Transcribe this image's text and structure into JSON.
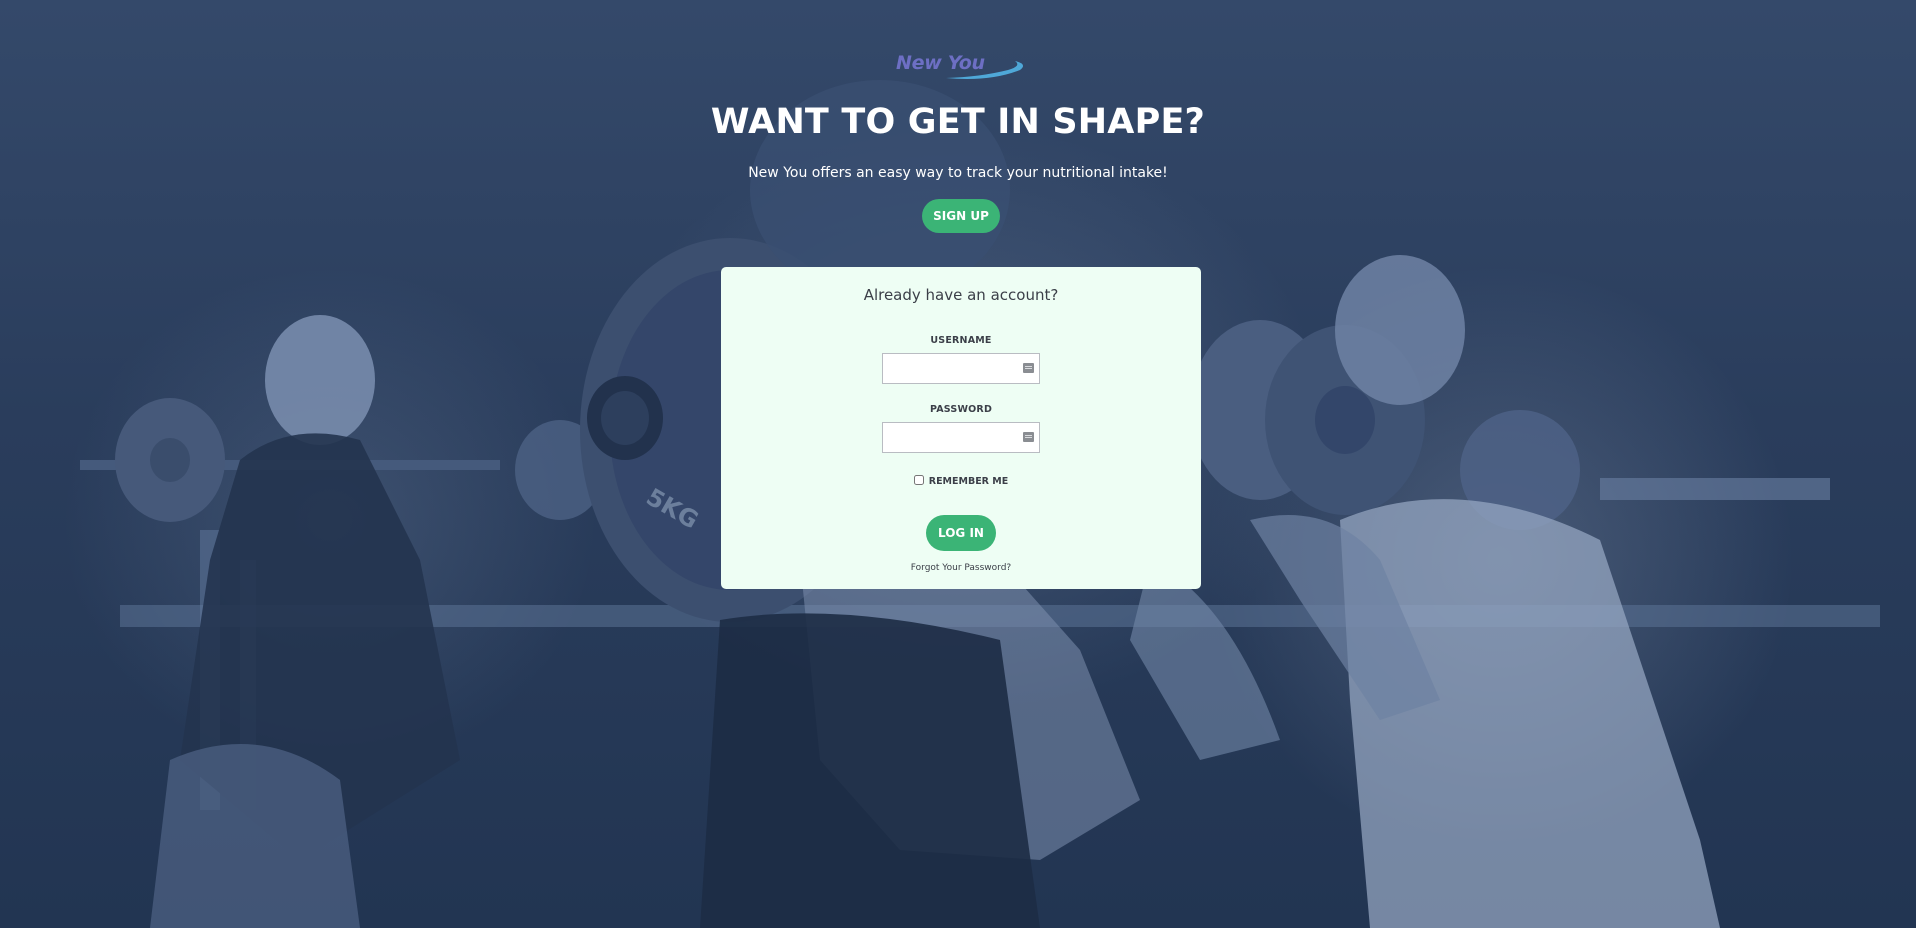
{
  "brand": {
    "logo_text": "New You",
    "logo_color": "#6d6fc4",
    "swoosh_color": "#4fa8d8"
  },
  "hero": {
    "headline": "WANT TO GET IN SHAPE?",
    "subhead": "New You offers an easy way to track your nutritional intake!",
    "signup_label": "SIGN UP"
  },
  "login": {
    "title": "Already have an account?",
    "username_label": "USERNAME",
    "username_value": "",
    "password_label": "PASSWORD",
    "password_value": "",
    "remember_label": "REMEMBER ME",
    "remember_checked": false,
    "login_label": "LOG IN",
    "forgot_label": "Forgot Your Password?"
  },
  "background": {
    "plate_text": "5KG"
  },
  "colors": {
    "accent": "#3bb476",
    "card_bg": "#eefef4",
    "overlay": "#2b3f5e"
  }
}
